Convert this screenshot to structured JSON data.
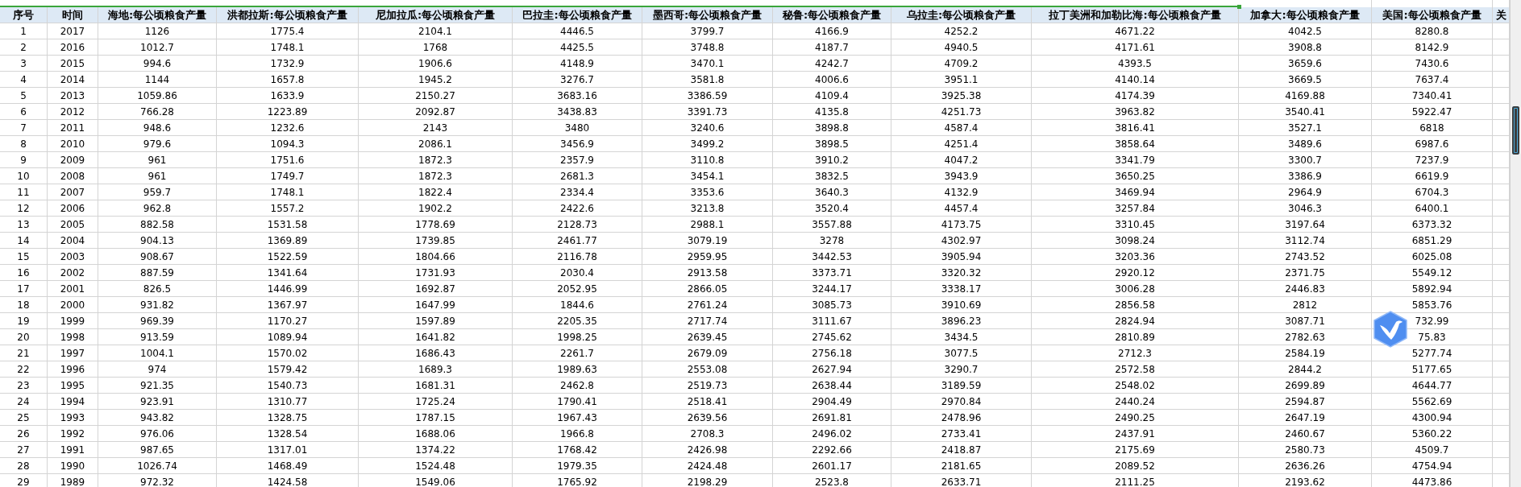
{
  "table": {
    "columns": [
      "序号",
      "时间",
      "海地:每公顷粮食产量",
      "洪都拉斯:每公顷粮食产量",
      "尼加拉瓜:每公顷粮食产量",
      "巴拉圭:每公顷粮食产量",
      "墨西哥:每公顷粮食产量",
      "秘鲁:每公顷粮食产量",
      "乌拉圭:每公顷粮食产量",
      "拉丁美洲和加勒比海:每公顷粮食产量",
      "加拿大:每公顷粮食产量",
      "美国:每公顷粮食产量",
      "关"
    ],
    "rows": [
      [
        "1",
        "2017",
        "1126",
        "1775.4",
        "2104.1",
        "4446.5",
        "3799.7",
        "4166.9",
        "4252.2",
        "4671.22",
        "4042.5",
        "8280.8"
      ],
      [
        "2",
        "2016",
        "1012.7",
        "1748.1",
        "1768",
        "4425.5",
        "3748.8",
        "4187.7",
        "4940.5",
        "4171.61",
        "3908.8",
        "8142.9"
      ],
      [
        "3",
        "2015",
        "994.6",
        "1732.9",
        "1906.6",
        "4148.9",
        "3470.1",
        "4242.7",
        "4709.2",
        "4393.5",
        "3659.6",
        "7430.6"
      ],
      [
        "4",
        "2014",
        "1144",
        "1657.8",
        "1945.2",
        "3276.7",
        "3581.8",
        "4006.6",
        "3951.1",
        "4140.14",
        "3669.5",
        "7637.4"
      ],
      [
        "5",
        "2013",
        "1059.86",
        "1633.9",
        "2150.27",
        "3683.16",
        "3386.59",
        "4109.4",
        "3925.38",
        "4174.39",
        "4169.88",
        "7340.41"
      ],
      [
        "6",
        "2012",
        "766.28",
        "1223.89",
        "2092.87",
        "3438.83",
        "3391.73",
        "4135.8",
        "4251.73",
        "3963.82",
        "3540.41",
        "5922.47"
      ],
      [
        "7",
        "2011",
        "948.6",
        "1232.6",
        "2143",
        "3480",
        "3240.6",
        "3898.8",
        "4587.4",
        "3816.41",
        "3527.1",
        "6818"
      ],
      [
        "8",
        "2010",
        "979.6",
        "1094.3",
        "2086.1",
        "3456.9",
        "3499.2",
        "3898.5",
        "4251.4",
        "3858.64",
        "3489.6",
        "6987.6"
      ],
      [
        "9",
        "2009",
        "961",
        "1751.6",
        "1872.3",
        "2357.9",
        "3110.8",
        "3910.2",
        "4047.2",
        "3341.79",
        "3300.7",
        "7237.9"
      ],
      [
        "10",
        "2008",
        "961",
        "1749.7",
        "1872.3",
        "2681.3",
        "3454.1",
        "3832.5",
        "3943.9",
        "3650.25",
        "3386.9",
        "6619.9"
      ],
      [
        "11",
        "2007",
        "959.7",
        "1748.1",
        "1822.4",
        "2334.4",
        "3353.6",
        "3640.3",
        "4132.9",
        "3469.94",
        "2964.9",
        "6704.3"
      ],
      [
        "12",
        "2006",
        "962.8",
        "1557.2",
        "1902.2",
        "2422.6",
        "3213.8",
        "3520.4",
        "4457.4",
        "3257.84",
        "3046.3",
        "6400.1"
      ],
      [
        "13",
        "2005",
        "882.58",
        "1531.58",
        "1778.69",
        "2128.73",
        "2988.1",
        "3557.88",
        "4173.75",
        "3310.45",
        "3197.64",
        "6373.32"
      ],
      [
        "14",
        "2004",
        "904.13",
        "1369.89",
        "1739.85",
        "2461.77",
        "3079.19",
        "3278",
        "4302.97",
        "3098.24",
        "3112.74",
        "6851.29"
      ],
      [
        "15",
        "2003",
        "908.67",
        "1522.59",
        "1804.66",
        "2116.78",
        "2959.95",
        "3442.53",
        "3905.94",
        "3203.36",
        "2743.52",
        "6025.08"
      ],
      [
        "16",
        "2002",
        "887.59",
        "1341.64",
        "1731.93",
        "2030.4",
        "2913.58",
        "3373.71",
        "3320.32",
        "2920.12",
        "2371.75",
        "5549.12"
      ],
      [
        "17",
        "2001",
        "826.5",
        "1446.99",
        "1692.87",
        "2052.95",
        "2866.05",
        "3244.17",
        "3338.17",
        "3006.28",
        "2446.83",
        "5892.94"
      ],
      [
        "18",
        "2000",
        "931.82",
        "1367.97",
        "1647.99",
        "1844.6",
        "2761.24",
        "3085.73",
        "3910.69",
        "2856.58",
        "2812",
        "5853.76"
      ],
      [
        "19",
        "1999",
        "969.39",
        "1170.27",
        "1597.89",
        "2205.35",
        "2717.74",
        "3111.67",
        "3896.23",
        "2824.94",
        "3087.71",
        "732.99"
      ],
      [
        "20",
        "1998",
        "913.59",
        "1089.94",
        "1641.82",
        "1998.25",
        "2639.45",
        "2745.62",
        "3434.5",
        "2810.89",
        "2782.63",
        "75.83"
      ],
      [
        "21",
        "1997",
        "1004.1",
        "1570.02",
        "1686.43",
        "2261.7",
        "2679.09",
        "2756.18",
        "3077.5",
        "2712.3",
        "2584.19",
        "5277.74"
      ],
      [
        "22",
        "1996",
        "974",
        "1579.42",
        "1689.3",
        "1989.63",
        "2553.08",
        "2627.94",
        "3290.7",
        "2572.58",
        "2844.2",
        "5177.65"
      ],
      [
        "23",
        "1995",
        "921.35",
        "1540.73",
        "1681.31",
        "2462.8",
        "2519.73",
        "2638.44",
        "3189.59",
        "2548.02",
        "2699.89",
        "4644.77"
      ],
      [
        "24",
        "1994",
        "923.91",
        "1310.77",
        "1725.24",
        "1790.41",
        "2518.41",
        "2904.49",
        "2970.84",
        "2440.24",
        "2594.87",
        "5562.69"
      ],
      [
        "25",
        "1993",
        "943.82",
        "1328.75",
        "1787.15",
        "1967.43",
        "2639.56",
        "2691.81",
        "2478.96",
        "2490.25",
        "2647.19",
        "4300.94"
      ],
      [
        "26",
        "1992",
        "976.06",
        "1328.54",
        "1688.06",
        "1966.8",
        "2708.3",
        "2496.02",
        "2733.41",
        "2437.91",
        "2460.67",
        "5360.22"
      ],
      [
        "27",
        "1991",
        "987.65",
        "1317.01",
        "1374.22",
        "1768.42",
        "2426.98",
        "2292.66",
        "2418.87",
        "2175.69",
        "2580.73",
        "4509.7"
      ],
      [
        "28",
        "1990",
        "1026.74",
        "1468.49",
        "1524.48",
        "1979.35",
        "2424.48",
        "2601.17",
        "2181.65",
        "2089.52",
        "2636.26",
        "4754.94"
      ],
      [
        "29",
        "1989",
        "972.32",
        "1424.58",
        "1549.06",
        "1765.92",
        "2198.29",
        "2523.8",
        "2633.71",
        "2111.25",
        "2193.62",
        "4473.86"
      ]
    ]
  }
}
